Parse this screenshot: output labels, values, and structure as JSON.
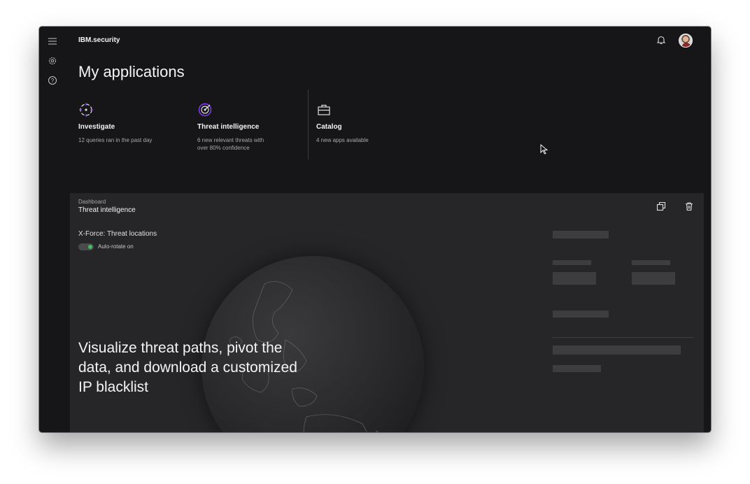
{
  "header": {
    "brand_prefix": "IBM",
    "brand_suffix": ".security"
  },
  "rail": {
    "icons": [
      "menu-icon",
      "settings-icon",
      "help-icon"
    ]
  },
  "page": {
    "title": "My applications"
  },
  "tiles": [
    {
      "title": "Investigate",
      "desc": "12 queries ran in the past day",
      "icon": "investigate-icon"
    },
    {
      "title": "Threat intelligence",
      "desc": "6 new relevant threats with over 80% confidence",
      "icon": "threat-icon"
    },
    {
      "title": "Catalog",
      "desc": "4 new apps available",
      "icon": "briefcase-icon"
    }
  ],
  "panel": {
    "kicker": "Dashboard",
    "title": "Threat intelligence",
    "widget_title": "X-Force: Threat locations",
    "toggle_label": "Auto-rotate on",
    "overlay": "Visualize threat paths, pivot the data, and download a customized IP blacklist"
  },
  "colors": {
    "background": "#161619",
    "panel": "#262628",
    "accent_purple": "#8a3ffc",
    "toggle_on": "#42be65"
  }
}
